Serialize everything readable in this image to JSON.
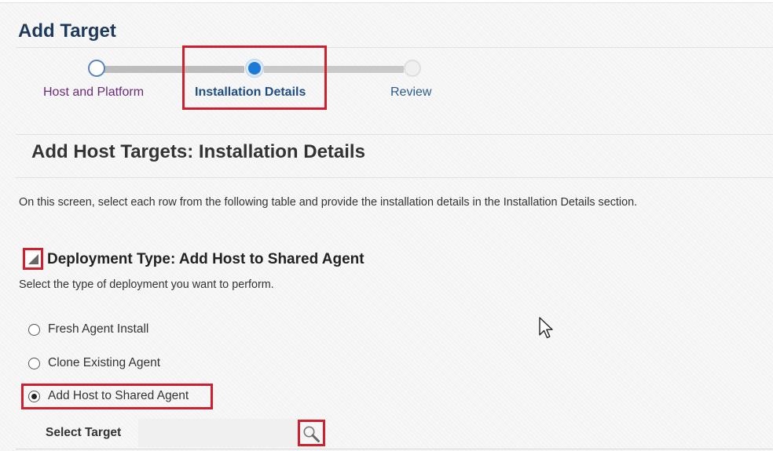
{
  "page": {
    "title": "Add Target"
  },
  "train": {
    "steps": [
      {
        "label": "Host and Platform",
        "state": "visited"
      },
      {
        "label": "Installation Details",
        "state": "current"
      },
      {
        "label": "Review",
        "state": "unvisited"
      }
    ]
  },
  "section": {
    "title": "Add Host Targets: Installation Details",
    "instructions": "On this screen, select each row from the following table and provide the installation details in the Installation Details section."
  },
  "deployment": {
    "header": "Deployment Type: Add Host to Shared Agent",
    "subtitle": "Select the type of deployment you want to perform.",
    "options": [
      {
        "label": "Fresh Agent Install",
        "checked": false
      },
      {
        "label": "Clone Existing Agent",
        "checked": false
      },
      {
        "label": "Add Host to Shared Agent",
        "checked": true
      }
    ],
    "select_target_label": "Select Target",
    "select_target_value": ""
  },
  "icons": {
    "collapse": "triangle-collapse-icon",
    "search": "magnifier-icon",
    "cursor": "mouse-pointer-icon"
  },
  "colors": {
    "highlight": "#d0202f",
    "title": "#1d3a5c",
    "current_step": "#1b7ad6"
  }
}
